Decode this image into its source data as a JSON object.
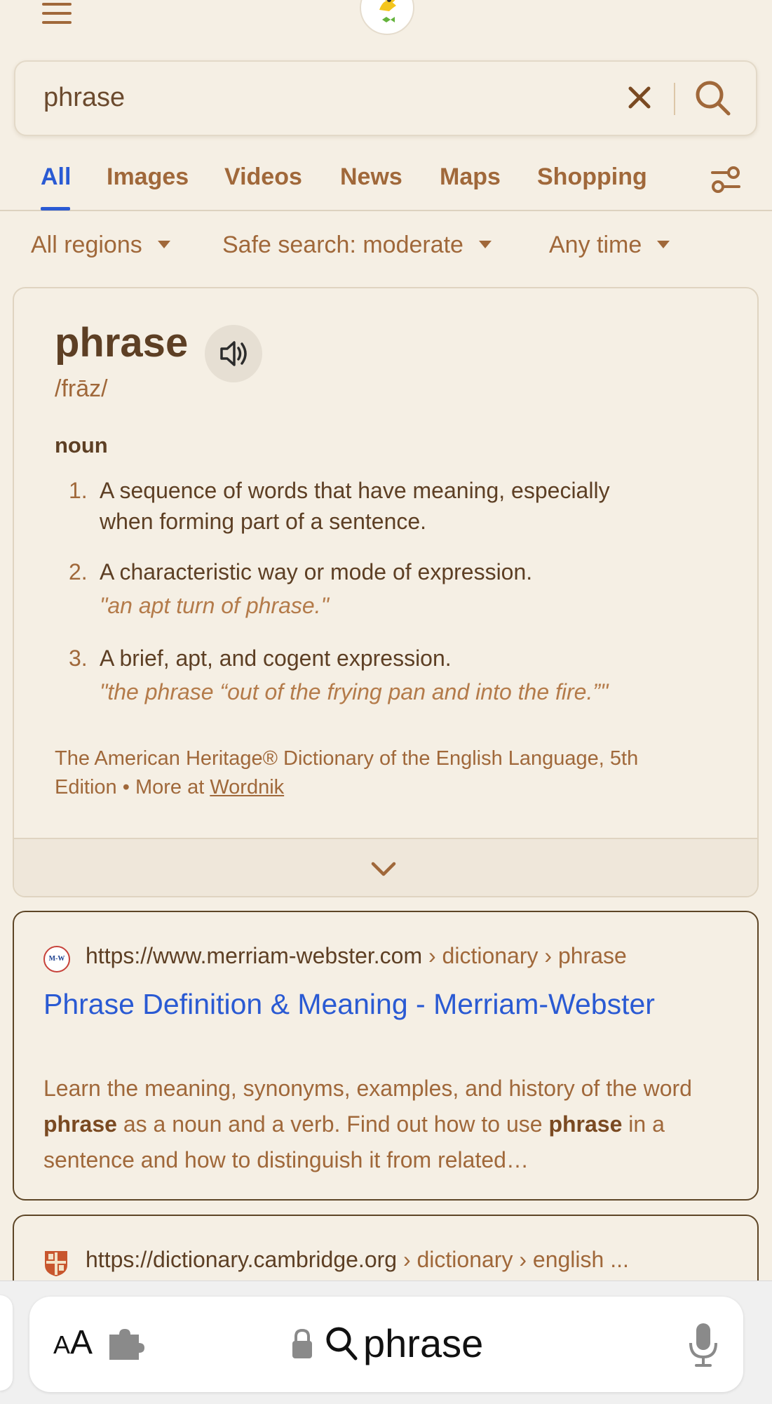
{
  "search": {
    "query": "phrase"
  },
  "tabs": [
    {
      "label": "All",
      "active": true
    },
    {
      "label": "Images"
    },
    {
      "label": "Videos"
    },
    {
      "label": "News"
    },
    {
      "label": "Maps"
    },
    {
      "label": "Shopping"
    }
  ],
  "filters": {
    "region": "All regions",
    "safe_search": "Safe search: moderate",
    "time": "Any time"
  },
  "dictionary": {
    "word": "phrase",
    "pronunciation": "/frāz/",
    "part_of_speech": "noun",
    "definitions": [
      {
        "num": "1.",
        "line1": "A sequence of words that have meaning, especially",
        "line2": "when forming part of a sentence."
      },
      {
        "num": "2.",
        "line1": "A characteristic way or mode of expression.",
        "example": "\"an apt turn of phrase.\""
      },
      {
        "num": "3.",
        "line1": "A brief, apt, and cogent expression.",
        "example": "\"the phrase “out of the frying pan and into the fire.”\""
      }
    ],
    "source_line1": "The American Heritage® Dictionary of the English Language, 5th",
    "source_line2_a": "Edition •  More at ",
    "source_link": "Wordnik"
  },
  "results": [
    {
      "favicon": "M-W",
      "domain": "https://www.merriam-webster.com",
      "path": " › dictionary › phrase",
      "title": "Phrase Definition & Meaning - Merriam-Webster",
      "snippet_a": "Learn the meaning, synonyms, examples, and history of the word ",
      "snippet_b": "phrase",
      "snippet_c": " as a noun and a verb. Find out how to use ",
      "snippet_d": "phrase",
      "snippet_e": " in a sentence and how to distinguish it from related…"
    },
    {
      "domain": "https://dictionary.cambridge.org",
      "path": " › dictionary › english ..."
    }
  ],
  "browser": {
    "aa_small": "A",
    "aa_large": "A",
    "address_query": "phrase"
  },
  "colors": {
    "background": "#f5efe4",
    "accent_blue": "#2a5ad3",
    "brown_text": "#a0683a",
    "dark_brown": "#5d3f24"
  }
}
